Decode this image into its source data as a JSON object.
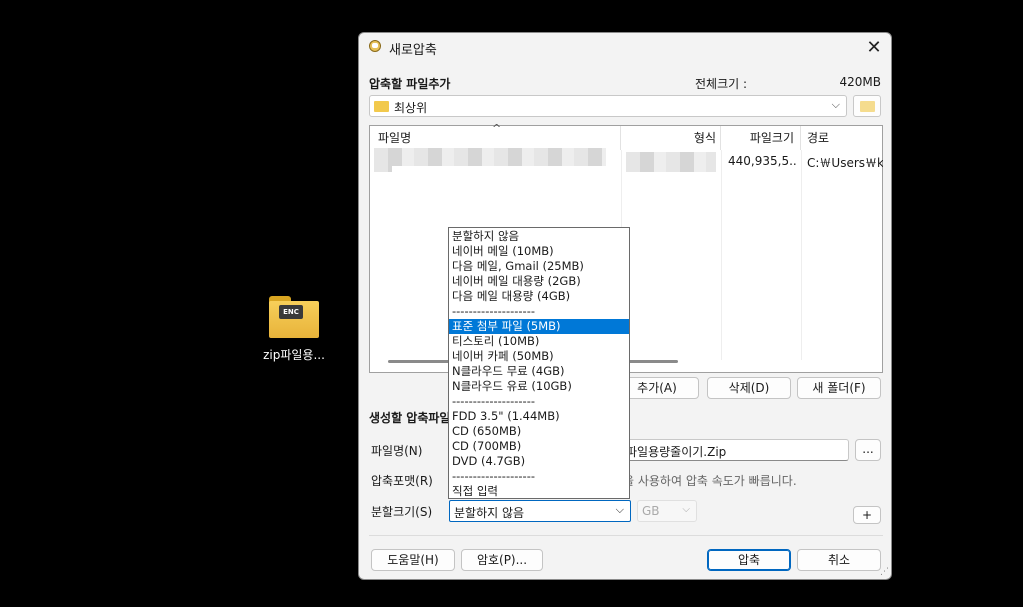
{
  "desktop": {
    "icon_label": "zip파일용...",
    "icon_badge": "ENC"
  },
  "dialog": {
    "title": "새로압축",
    "add_section": {
      "title": "압축할 파일추가",
      "total_size_label": "전체크기 :",
      "total_size_value": "420MB"
    },
    "path_combo": {
      "value": "최상위"
    },
    "file_list": {
      "columns": [
        "파일명",
        "형식",
        "파일크기",
        "경로"
      ],
      "rows": [
        {
          "name": "",
          "type": "",
          "size": "440,935,5...",
          "path": "C:￦Users￦kim"
        }
      ]
    },
    "list_buttons": {
      "add": "추가(A)",
      "delete": "삭제(D)",
      "new_folder": "새 폴더(F)"
    },
    "create_section": {
      "title": "생성할 압축파일",
      "filename_label": "파일명(N)",
      "filename_value": "파일용량줄이기.Zip",
      "browse_label": "...",
      "format_label": "압축포맷(R)",
      "format_hint": "을 사용하여 압축 속도가 빠릅니다.",
      "split_label": "분할크기(S)",
      "split_value": "분할하지 않음",
      "unit_value": "GB",
      "plus_label": "+"
    },
    "footer": {
      "help": "도움말(H)",
      "password": "암호(P)...",
      "compress": "압축",
      "cancel": "취소"
    }
  },
  "dropdown": {
    "options": [
      "분할하지 않음",
      "네이버 메일 (10MB)",
      "다음 메일, Gmail (25MB)",
      "네이버 메일 대용량 (2GB)",
      "다음 메일 대용량 (4GB)",
      "--------------------",
      "표준 첨부 파일 (5MB)",
      "티스토리 (10MB)",
      "네이버 카페 (50MB)",
      "N클라우드 무료 (4GB)",
      "N클라우드 유료 (10GB)",
      "--------------------",
      "FDD 3.5\" (1.44MB)",
      "CD (650MB)",
      "CD (700MB)",
      "DVD (4.7GB)",
      "--------------------",
      "직접 입력"
    ],
    "selected_index": 6
  }
}
